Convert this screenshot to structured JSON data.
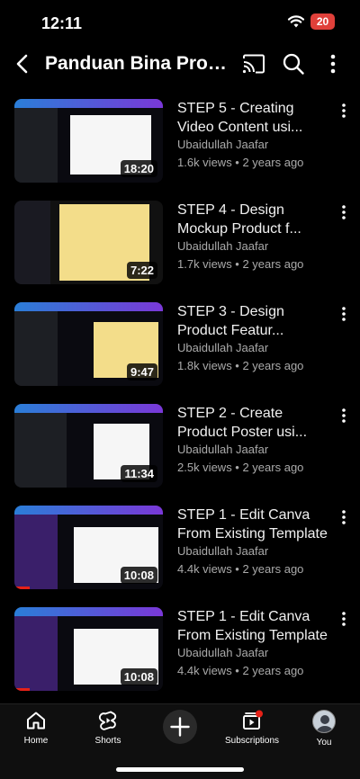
{
  "status": {
    "time": "12:11",
    "battery": "20"
  },
  "header": {
    "title": "Panduan Bina Produk"
  },
  "videos": [
    {
      "title": "STEP 5 - Creating Video Content usi...",
      "channel": "Ubaidullah Jaafar",
      "meta": "1.6k views • 2 years ago",
      "duration": "18:20",
      "progress": 0
    },
    {
      "title": "STEP 4 - Design Mockup Product f...",
      "channel": "Ubaidullah Jaafar",
      "meta": "1.7k views • 2 years ago",
      "duration": "7:22",
      "progress": 0
    },
    {
      "title": "STEP 3 - Design Product Featur...",
      "channel": "Ubaidullah Jaafar",
      "meta": "1.8k views • 2 years ago",
      "duration": "9:47",
      "progress": 0
    },
    {
      "title": "STEP 2 - Create Product Poster usi...",
      "channel": "Ubaidullah Jaafar",
      "meta": "2.5k views • 2 years ago",
      "duration": "11:34",
      "progress": 0
    },
    {
      "title": "STEP 1 - Edit Canva From Existing Template",
      "channel": "Ubaidullah Jaafar",
      "meta": "4.4k views • 2 years ago",
      "duration": "10:08",
      "progress": 0.1
    },
    {
      "title": "STEP 1 - Edit Canva From Existing Template",
      "channel": "Ubaidullah Jaafar",
      "meta": "4.4k views • 2 years ago",
      "duration": "10:08",
      "progress": 0.1
    }
  ],
  "nav": {
    "home": "Home",
    "shorts": "Shorts",
    "subscriptions": "Subscriptions",
    "you": "You"
  },
  "colors": {
    "background": "#000000",
    "accent_red": "#e62117",
    "battery": "#e0403a"
  }
}
